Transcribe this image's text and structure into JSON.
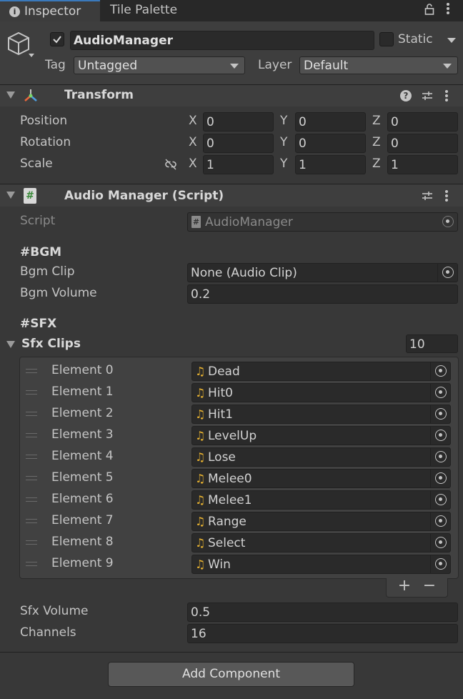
{
  "tabs": [
    {
      "label": "Inspector"
    },
    {
      "label": "Tile Palette"
    }
  ],
  "object": {
    "name": "AudioManager",
    "static_label": "Static",
    "tag_label": "Tag",
    "tag_value": "Untagged",
    "layer_label": "Layer",
    "layer_value": "Default"
  },
  "transform": {
    "title": "Transform",
    "rows": [
      {
        "label": "Position",
        "x": "0",
        "y": "0",
        "z": "0"
      },
      {
        "label": "Rotation",
        "x": "0",
        "y": "0",
        "z": "0"
      },
      {
        "label": "Scale",
        "x": "1",
        "y": "1",
        "z": "1"
      }
    ],
    "axis_labels": {
      "x": "X",
      "y": "Y",
      "z": "Z"
    }
  },
  "script_component": {
    "title": "Audio Manager (Script)",
    "script_label": "Script",
    "script_value": "AudioManager",
    "bgm_header": "#BGM",
    "bgm_clip_label": "Bgm Clip",
    "bgm_clip_value": "None (Audio Clip)",
    "bgm_volume_label": "Bgm Volume",
    "bgm_volume_value": "0.2",
    "sfx_header": "#SFX",
    "sfx_clips_label": "Sfx Clips",
    "sfx_clips_count": "10",
    "elements": [
      {
        "label": "Element 0",
        "value": "Dead"
      },
      {
        "label": "Element 1",
        "value": "Hit0"
      },
      {
        "label": "Element 2",
        "value": "Hit1"
      },
      {
        "label": "Element 3",
        "value": "LevelUp"
      },
      {
        "label": "Element 4",
        "value": "Lose"
      },
      {
        "label": "Element 5",
        "value": "Melee0"
      },
      {
        "label": "Element 6",
        "value": "Melee1"
      },
      {
        "label": "Element 7",
        "value": "Range"
      },
      {
        "label": "Element 8",
        "value": "Select"
      },
      {
        "label": "Element 9",
        "value": "Win"
      }
    ],
    "add_symbol": "+",
    "remove_symbol": "−",
    "sfx_volume_label": "Sfx Volume",
    "sfx_volume_value": "0.5",
    "channels_label": "Channels",
    "channels_value": "16"
  },
  "footer": {
    "add_component_label": "Add Component"
  },
  "colors": {
    "panel_bg": "#383838",
    "header_bg": "#3e3e3e",
    "tab_bar_bg": "#282828",
    "field_bg": "#2a2a2a",
    "audio_icon": "#e8b230"
  }
}
